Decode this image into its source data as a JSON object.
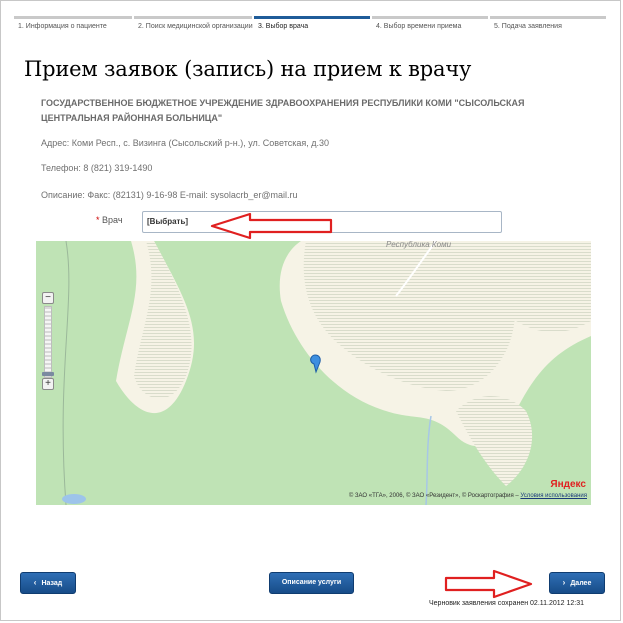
{
  "steps": [
    {
      "label": "1. Информация о пациенте",
      "active": false
    },
    {
      "label": "2. Поиск медицинской организации",
      "active": false
    },
    {
      "label": "3. Выбор врача",
      "active": true
    },
    {
      "label": "4. Выбор времени приема",
      "active": false
    },
    {
      "label": "5. Подача заявления",
      "active": false
    }
  ],
  "page": {
    "title": "Прием заявок (запись) на прием к врачу",
    "org_name": "ГОСУДАРСТВЕННОЕ БЮДЖЕТНОЕ УЧРЕЖДЕНИЕ ЗДРАВООХРАНЕНИЯ РЕСПУБЛИКИ КОМИ \"СЫСОЛЬСКАЯ ЦЕНТРАЛЬНАЯ РАЙОННАЯ БОЛЬНИЦА\"",
    "address": "Адрес: Коми Респ., с. Визинга (Сысольский р-н.), ул. Советская, д.30",
    "phone": "Телефон: 8 (821) 319-1490",
    "description": "Описание: Факс: (82131) 9-16-98 E-mail: sysolacrb_er@mail.ru"
  },
  "doctor": {
    "required_mark": "*",
    "label": "Врач",
    "value": "[Выбрать]"
  },
  "map": {
    "region_label": "Республика Коми",
    "brand": "Яндекс",
    "copyright": "© ЗАО «ТГА», 2006, © ЗАО «Резидент», © Роскартография –",
    "terms_link": "Условия использования",
    "zoom_in": "+",
    "zoom_out": "−"
  },
  "buttons": {
    "back": "Назад",
    "service": "Описание услуги",
    "next": "Далее"
  },
  "status": {
    "draft_saved": "Черновик заявления сохранен 02.11.2012 12:31"
  },
  "colors": {
    "accent": "#1f5c99",
    "button": "#1f5c99",
    "map_green": "#bfe3b5",
    "annotation_arrow": "#e02020"
  }
}
